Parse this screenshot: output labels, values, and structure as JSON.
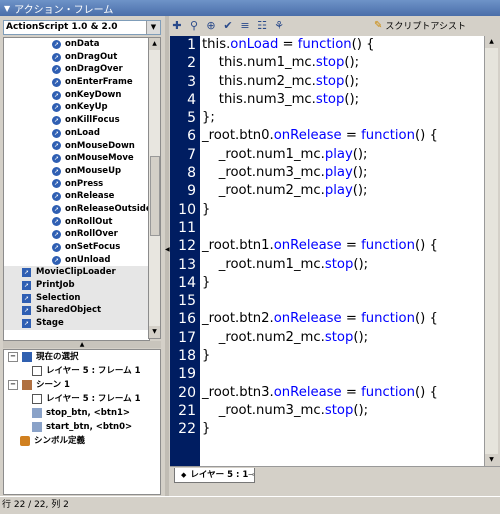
{
  "panel_title": "アクション・フレーム",
  "language_select": {
    "value": "ActionScript 1.0 & 2.0"
  },
  "event_items": [
    "onData",
    "onDragOut",
    "onDragOver",
    "onEnterFrame",
    "onKeyDown",
    "onKeyUp",
    "onKillFocus",
    "onLoad",
    "onMouseDown",
    "onMouseMove",
    "onMouseUp",
    "onPress",
    "onRelease",
    "onReleaseOutside",
    "onRollOut",
    "onRollOver",
    "onSetFocus",
    "onUnload"
  ],
  "class_items": [
    "MovieClipLoader",
    "PrintJob",
    "Selection",
    "SharedObject",
    "Stage"
  ],
  "scene_tree": {
    "current_selection": "現在の選択",
    "current_layer": "レイヤー 5 : フレーム 1",
    "scene": "シーン 1",
    "scene_layer": "レイヤー 5 : フレーム 1",
    "stop_btn": "stop_btn, <btn1>",
    "start_btn": "start_btn, <btn0>",
    "symbols": "シンボル定義"
  },
  "script_assist_label": "スクリプトアシスト",
  "code_lines": [
    "this.onLoad = function() {",
    "    this.num1_mc.stop();",
    "    this.num2_mc.stop();",
    "    this.num3_mc.stop();",
    "};",
    "_root.btn0.onRelease = function() {",
    "    _root.num1_mc.play();",
    "    _root.num3_mc.play();",
    "    _root.num2_mc.play();",
    "}",
    "",
    "_root.btn1.onRelease = function() {",
    "    _root.num1_mc.stop();",
    "}",
    "",
    "_root.btn2.onRelease = function() {",
    "    _root.num2_mc.stop();",
    "}",
    "",
    "_root.btn3.onRelease = function() {",
    "    _root.num3_mc.stop();",
    "}"
  ],
  "line_numbers": [
    "1",
    "2",
    "3",
    "4",
    "5",
    "6",
    "7",
    "8",
    "9",
    "10",
    "11",
    "12",
    "13",
    "14",
    "15",
    "16",
    "17",
    "18",
    "19",
    "20",
    "21",
    "22"
  ],
  "tab_label": "レイヤー 5 : 1",
  "status_text": "行 22 / 22, 列 2",
  "colors": {
    "editor_bg": "#001d61",
    "keyword": "#0000ff",
    "event_icon": "#2f5fb3"
  }
}
